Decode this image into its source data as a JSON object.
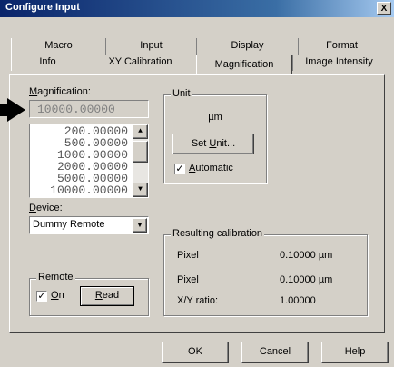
{
  "window": {
    "title": "Configure Input",
    "close_glyph": "X"
  },
  "tabs_row1": [
    "Macro",
    "Input",
    "Display",
    "Format"
  ],
  "tabs_row2": [
    "Info",
    "XY Calibration",
    "Magnification",
    "Image Intensity"
  ],
  "magnification": {
    "label_prefix": "",
    "label_access": "M",
    "label_rest": "agnification:",
    "value": "10000.00000",
    "list": [
      "200.00000",
      "500.00000",
      "1000.00000",
      "2000.00000",
      "5000.00000",
      "10000.00000"
    ]
  },
  "unit": {
    "group_label": "Unit",
    "value": "µm",
    "button_pre": "Set ",
    "button_access": "U",
    "button_post": "nit...",
    "automatic_access": "A",
    "automatic_rest": "utomatic",
    "automatic_checked": true
  },
  "device": {
    "label_access": "D",
    "label_rest": "evice:",
    "selected": "Dummy Remote"
  },
  "remote": {
    "group_label": "Remote",
    "on_access": "O",
    "on_rest": "n",
    "on_checked": true,
    "read_access": "R",
    "read_rest": "ead"
  },
  "calibration": {
    "group_label": "Resulting calibration",
    "rows": [
      {
        "label": "Pixel",
        "value": "0.10000 µm"
      },
      {
        "label": "Pixel",
        "value": "0.10000 µm"
      },
      {
        "label": "X/Y ratio:",
        "value": "1.00000"
      }
    ]
  },
  "buttons": {
    "ok": "OK",
    "cancel": "Cancel",
    "help": "Help"
  },
  "pointer": {
    "icon": "pointer-arrow-icon"
  }
}
